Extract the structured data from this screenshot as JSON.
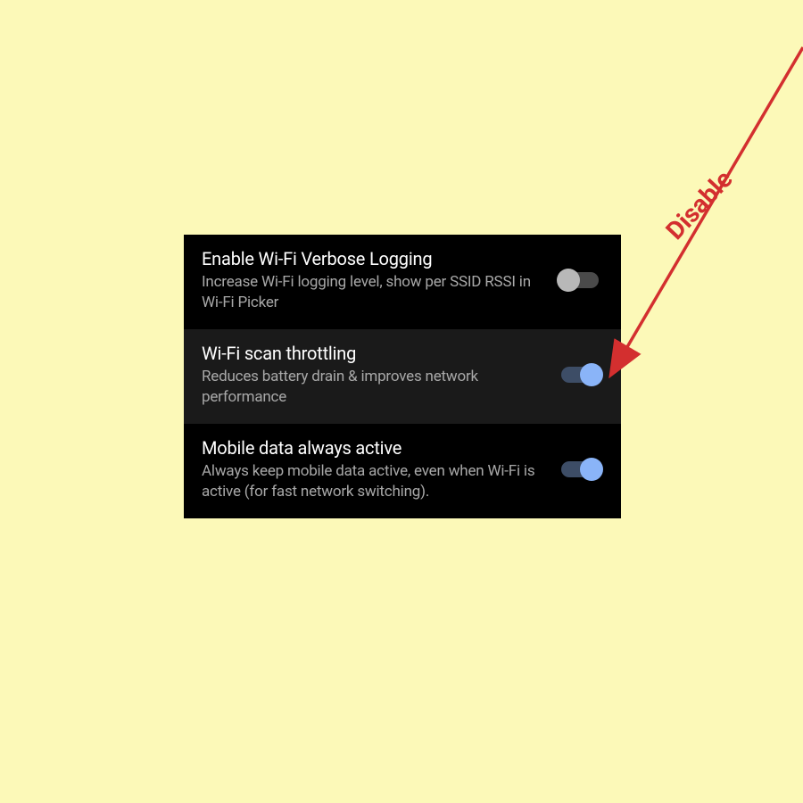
{
  "settings": [
    {
      "title": "Enable Wi-Fi Verbose Logging",
      "description": "Increase Wi-Fi logging level, show per SSID RSSI in Wi-Fi Picker",
      "enabled": false,
      "highlighted": false
    },
    {
      "title": "Wi-Fi scan throttling",
      "description": "Reduces battery drain & improves network performance",
      "enabled": true,
      "highlighted": true
    },
    {
      "title": "Mobile data always active",
      "description": "Always keep mobile data active, even when Wi-Fi is active (for fast network switching).",
      "enabled": true,
      "highlighted": false
    }
  ],
  "annotation": {
    "label": "Disable"
  },
  "colors": {
    "background": "#fcf9b8",
    "panel": "#000000",
    "highlight": "#1a1a1a",
    "toggleOn": "#8ab4f8",
    "annotation": "#d32f2f"
  }
}
